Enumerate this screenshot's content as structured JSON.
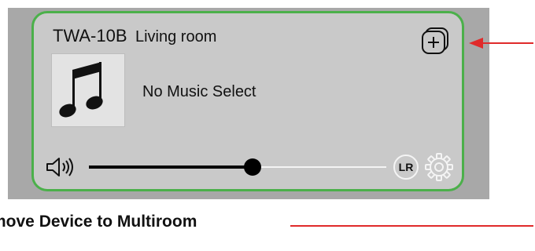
{
  "device_card": {
    "model": "TWA-10B",
    "room": "Living room",
    "song_title": "No Music Select",
    "icons": {
      "add": "add-to-group-icon",
      "art": "music-note-icon",
      "speaker": "speaker-icon",
      "settings": "gear-icon"
    },
    "volume": {
      "level_percent": 55
    },
    "channel_label": "LR",
    "accent_color": "#4bb04a"
  },
  "annotation": {
    "caption": "move Device to Multiroom",
    "pointer_color": "#e02a2a"
  }
}
